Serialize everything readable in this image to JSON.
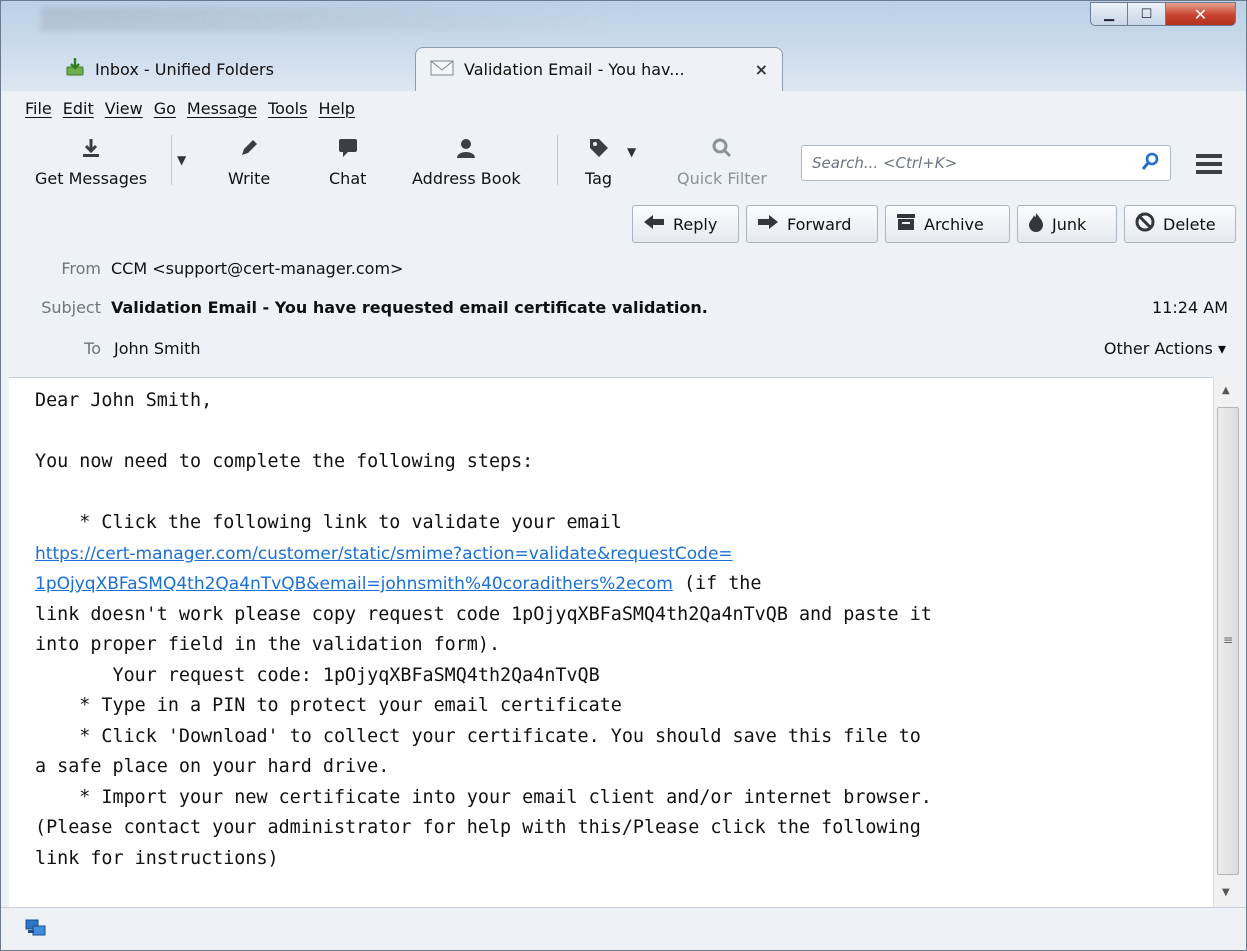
{
  "window": {
    "controls": {
      "minimize": "▁",
      "maximize": "☐",
      "close": "✕"
    }
  },
  "tabs": [
    {
      "label": "Inbox - Unified Folders",
      "icon": "inbox-download-icon"
    },
    {
      "label": "Validation Email - You hav...",
      "icon": "envelope-icon",
      "close": "×"
    }
  ],
  "menu": [
    "File",
    "Edit",
    "View",
    "Go",
    "Message",
    "Tools",
    "Help"
  ],
  "toolbar": {
    "get_messages": "Get Messages",
    "write": "Write",
    "chat": "Chat",
    "address_book": "Address Book",
    "tag": "Tag",
    "quick_filter": "Quick Filter",
    "search_placeholder": "Search... <Ctrl+K>"
  },
  "actions": {
    "reply": "Reply",
    "forward": "Forward",
    "archive": "Archive",
    "junk": "Junk",
    "delete": "Delete"
  },
  "header": {
    "from_label": "From",
    "from_value": "CCM <support@cert-manager.com>",
    "subject_label": "Subject",
    "subject_value": "Validation Email - You have requested email certificate validation.",
    "time": "11:24 AM",
    "to_label": "To",
    "to_value": "John Smith",
    "other_actions": "Other Actions ▾"
  },
  "message": {
    "greeting": "Dear John Smith,",
    "intro": "You now need to complete the following steps:",
    "step1": "    * Click the following link to validate your email",
    "link_line1": "https://cert-manager.com/customer/static/smime?action=validate&requestCode=",
    "link_line2": "1pOjyqXBFaSMQ4th2Qa4nTvQB&email=johnsmith%40coradithers%2ecom",
    "link_suffix": " (if the",
    "line_cont1": "link doesn't work please copy request code 1pOjyqXBFaSMQ4th2Qa4nTvQB and paste it",
    "line_cont2": "into proper field in the validation form).",
    "request_code": "       Your request code: 1pOjyqXBFaSMQ4th2Qa4nTvQB",
    "step2": "    * Type in a PIN to protect your email certificate",
    "step3a": "    * Click 'Download' to collect your certificate. You should save this file to",
    "step3b": "a safe place on your hard drive.",
    "step4a": "    * Import your new certificate into your email client and/or internet browser.",
    "step4b": "(Please contact your administrator for help with this/Please click the following",
    "step4c": "link for instructions)"
  }
}
